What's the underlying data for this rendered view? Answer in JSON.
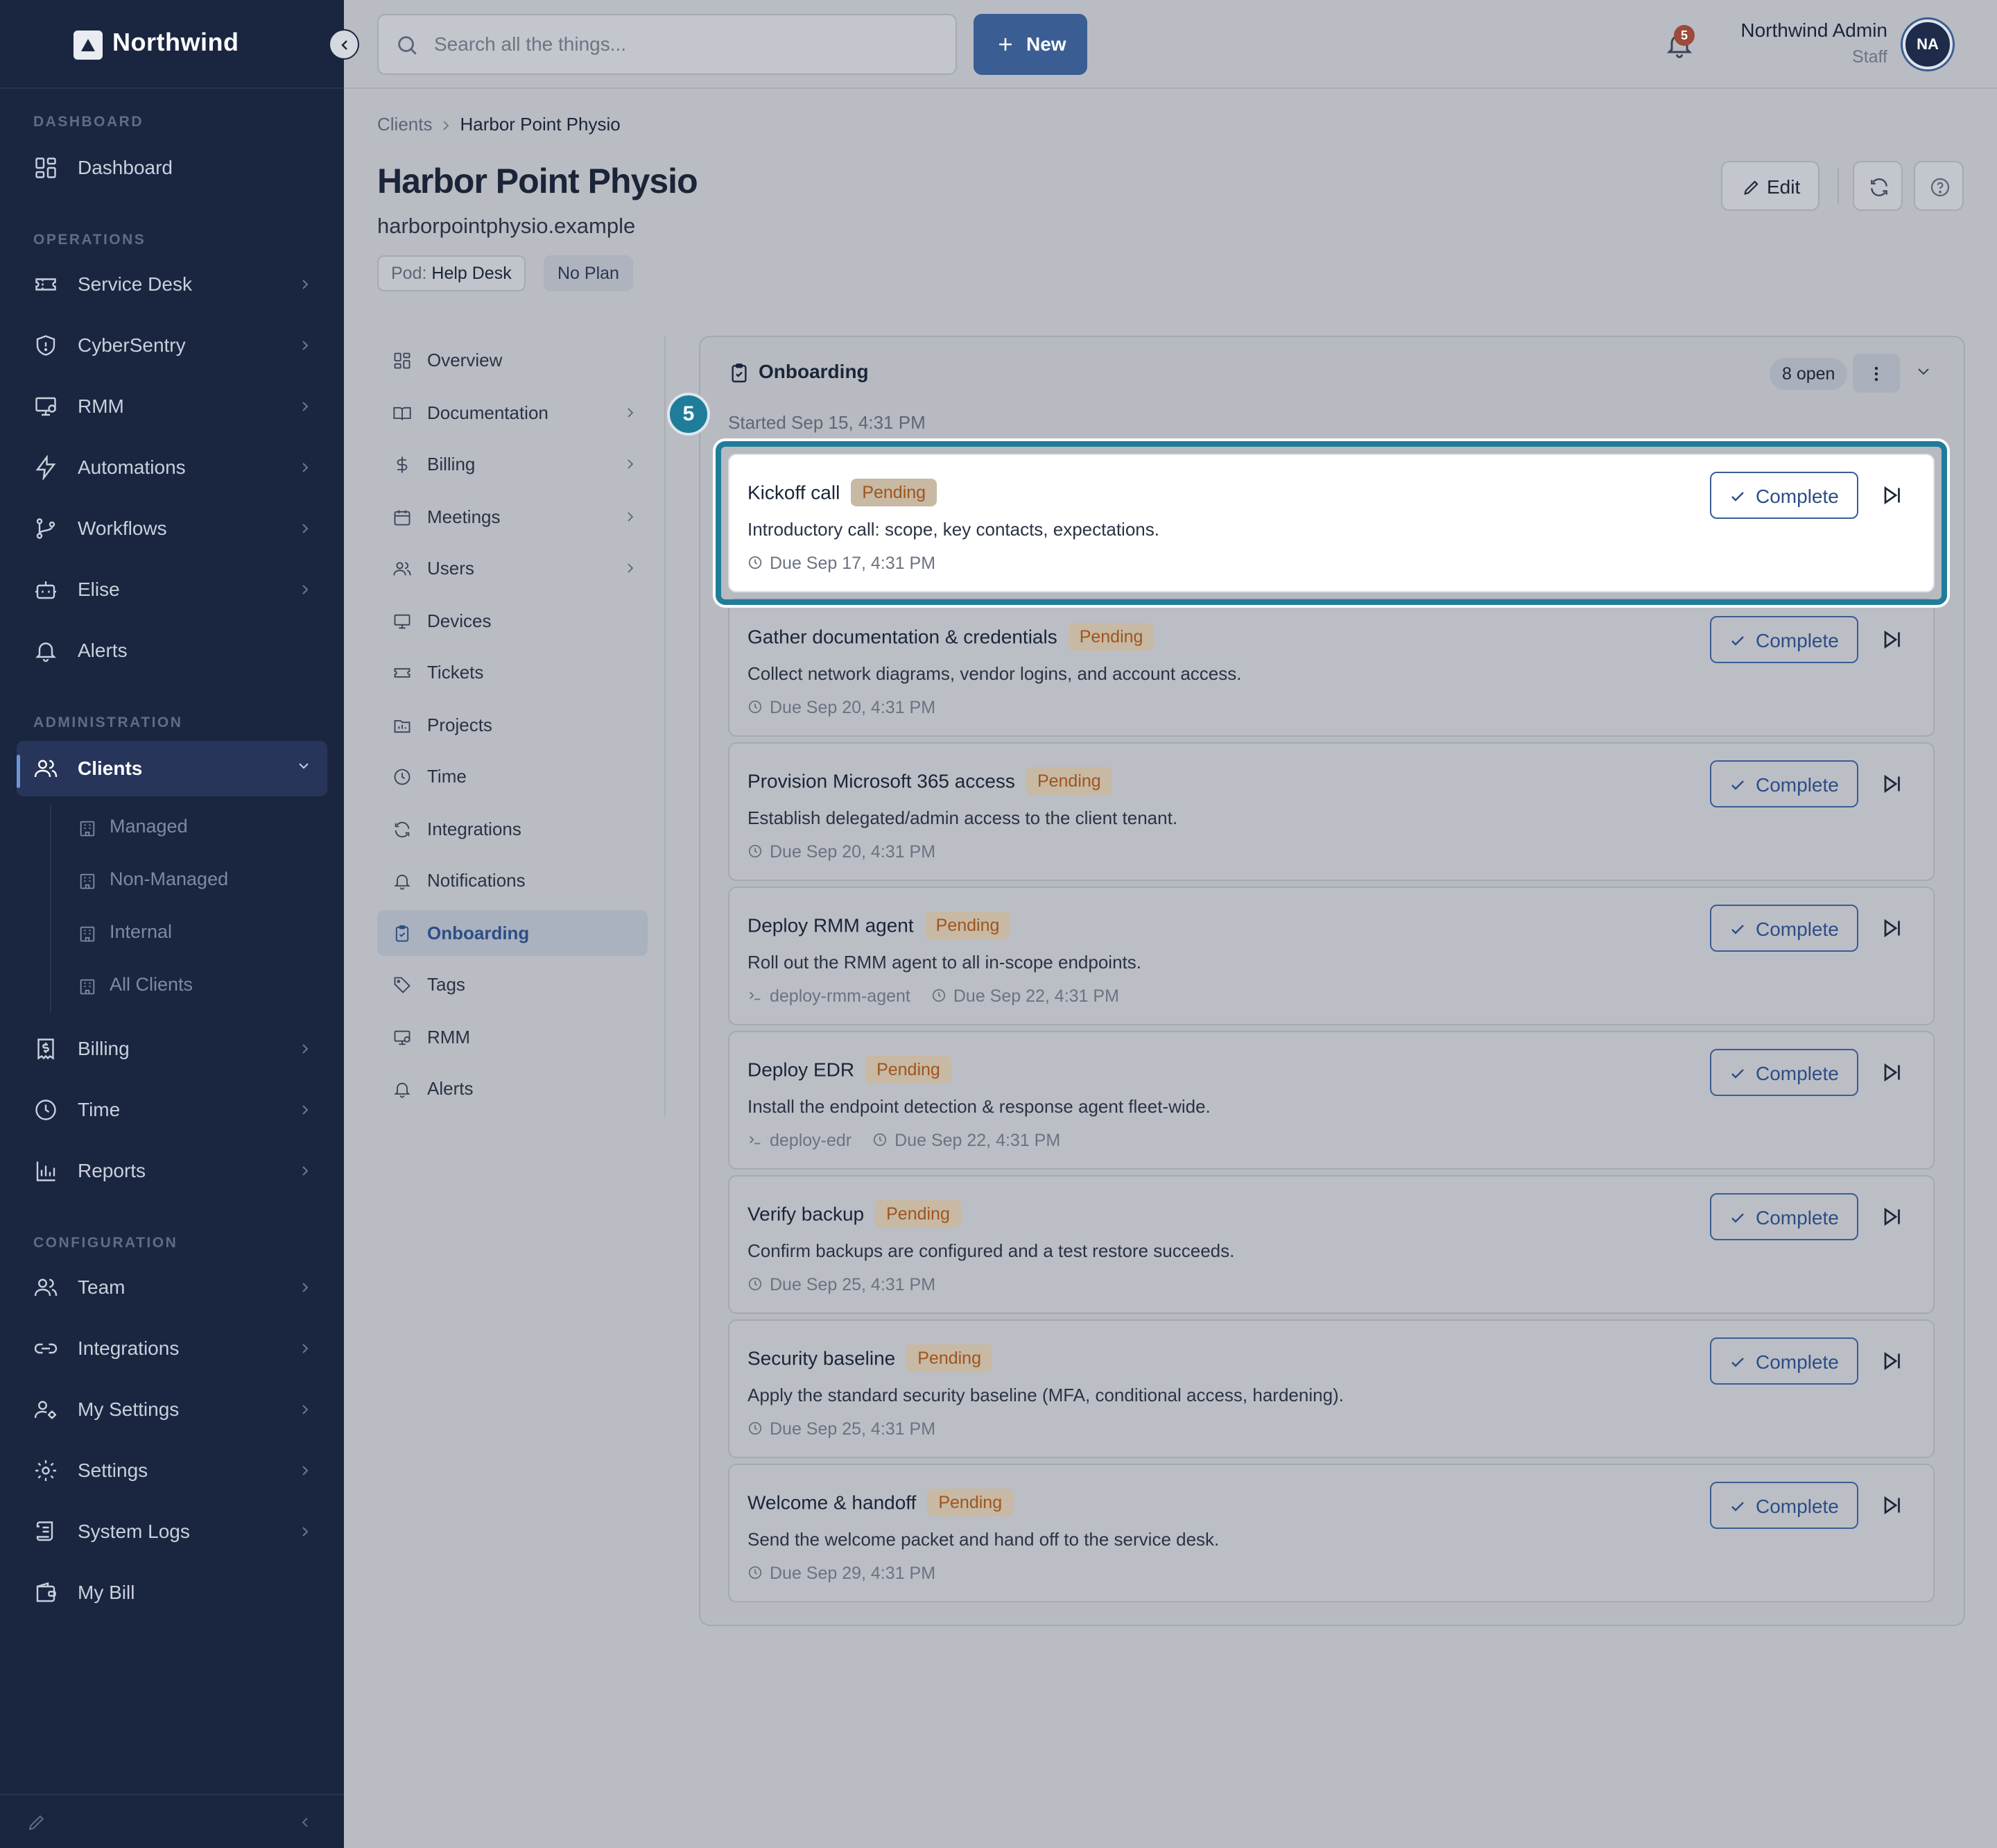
{
  "app": {
    "name": "Northwind"
  },
  "sidebar": {
    "sections": {
      "dashboard": "DASHBOARD",
      "operations": "OPERATIONS",
      "administration": "ADMINISTRATION",
      "configuration": "CONFIGURATION"
    },
    "items": {
      "dashboard": "Dashboard",
      "service_desk": "Service Desk",
      "cybersentry": "CyberSentry",
      "rmm": "RMM",
      "automations": "Automations",
      "workflows": "Workflows",
      "elise": "Elise",
      "alerts": "Alerts",
      "clients": "Clients",
      "billing": "Billing",
      "time": "Time",
      "reports": "Reports",
      "team": "Team",
      "integrations": "Integrations",
      "my_settings": "My Settings",
      "settings": "Settings",
      "system_logs": "System Logs",
      "my_bill": "My Bill"
    },
    "clients_sub": [
      "Managed",
      "Non-Managed",
      "Internal",
      "All Clients"
    ]
  },
  "topbar": {
    "search_placeholder": "Search all the things...",
    "new_label": "New",
    "notification_count": "5",
    "user_name": "Northwind Admin",
    "user_role": "Staff",
    "user_initials": "NA"
  },
  "breadcrumb": {
    "parent": "Clients",
    "current": "Harbor Point Physio"
  },
  "client": {
    "name": "Harbor Point Physio",
    "domain": "harborpointphysio.example",
    "pod_key": "Pod:",
    "pod_value": "Help Desk",
    "plan": "No Plan",
    "edit_label": "Edit"
  },
  "client_nav": {
    "overview": "Overview",
    "documentation": "Documentation",
    "billing": "Billing",
    "meetings": "Meetings",
    "users": "Users",
    "devices": "Devices",
    "tickets": "Tickets",
    "projects": "Projects",
    "time": "Time",
    "integrations": "Integrations",
    "notifications": "Notifications",
    "onboarding": "Onboarding",
    "tags": "Tags",
    "rmm": "RMM",
    "alerts": "Alerts"
  },
  "onboarding": {
    "title": "Onboarding",
    "open_count": "8 open",
    "started": "Started Sep 15, 4:31 PM",
    "step_number": "5",
    "complete_label": "Complete",
    "tasks": [
      {
        "title": "Kickoff call",
        "status": "Pending",
        "description": "Introductory call: scope, key contacts, expectations.",
        "script": "",
        "due": "Due Sep 17, 4:31 PM"
      },
      {
        "title": "Gather documentation & credentials",
        "status": "Pending",
        "description": "Collect network diagrams, vendor logins, and account access.",
        "script": "",
        "due": "Due Sep 20, 4:31 PM"
      },
      {
        "title": "Provision Microsoft 365 access",
        "status": "Pending",
        "description": "Establish delegated/admin access to the client tenant.",
        "script": "",
        "due": "Due Sep 20, 4:31 PM"
      },
      {
        "title": "Deploy RMM agent",
        "status": "Pending",
        "description": "Roll out the RMM agent to all in-scope endpoints.",
        "script": "deploy-rmm-agent",
        "due": "Due Sep 22, 4:31 PM"
      },
      {
        "title": "Deploy EDR",
        "status": "Pending",
        "description": "Install the endpoint detection & response agent fleet-wide.",
        "script": "deploy-edr",
        "due": "Due Sep 22, 4:31 PM"
      },
      {
        "title": "Verify backup",
        "status": "Pending",
        "description": "Confirm backups are configured and a test restore succeeds.",
        "script": "",
        "due": "Due Sep 25, 4:31 PM"
      },
      {
        "title": "Security baseline",
        "status": "Pending",
        "description": "Apply the standard security baseline (MFA, conditional access, hardening).",
        "script": "",
        "due": "Due Sep 25, 4:31 PM"
      },
      {
        "title": "Welcome & handoff",
        "status": "Pending",
        "description": "Send the welcome packet and hand off to the service desk.",
        "script": "",
        "due": "Due Sep 29, 4:31 PM"
      }
    ]
  },
  "colors": {
    "sidebar_bg": "#1a2540",
    "accent": "#3a5d93",
    "highlight_ring": "#1f7d9a",
    "pending_text": "#a0541f"
  }
}
